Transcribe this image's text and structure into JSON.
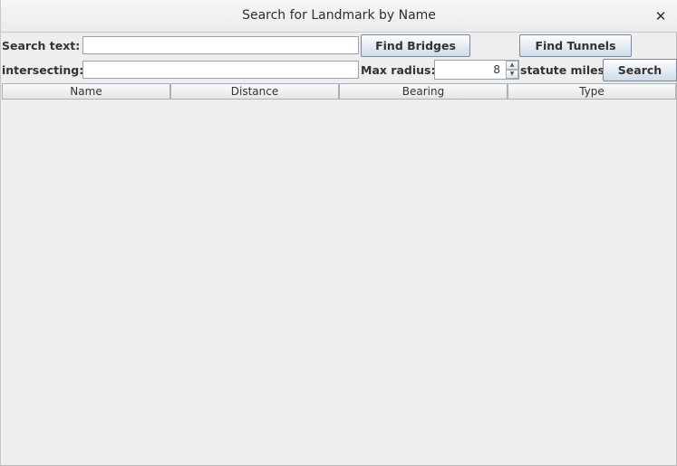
{
  "window": {
    "title": "Search for Landmark by Name",
    "close_glyph": "✕"
  },
  "form": {
    "search_text_label": "Search text:",
    "search_text_value": "",
    "find_bridges_label": "Find Bridges",
    "find_tunnels_label": "Find Tunnels",
    "intersecting_label": "intersecting:",
    "intersecting_value": "",
    "max_radius_label": "Max radius:",
    "max_radius_value": "8",
    "units_label": "statute miles",
    "search_button_label": "Search"
  },
  "table": {
    "columns": [
      "Name",
      "Distance",
      "Bearing",
      "Type"
    ],
    "rows": []
  },
  "icons": {
    "close": "close-icon",
    "spin_up": "chevron-up-icon",
    "spin_down": "chevron-down-icon"
  }
}
